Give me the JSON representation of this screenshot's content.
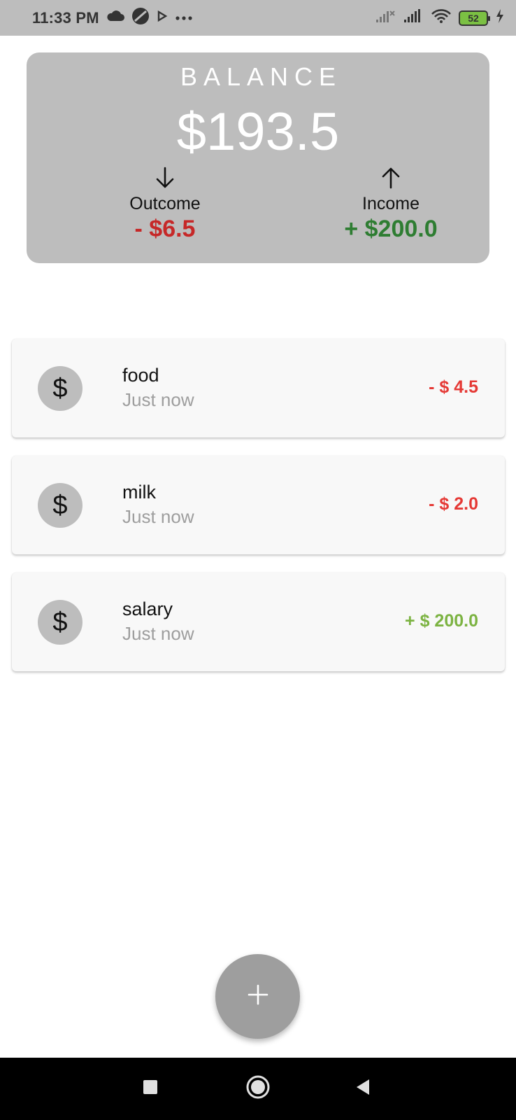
{
  "status_bar": {
    "time": "11:33 PM",
    "left_icons": [
      "cloud-icon",
      "vpn-icon",
      "play-icon",
      "more-dots-icon"
    ],
    "right_icons": [
      "signal-no-service-icon",
      "signal-icon",
      "wifi-icon",
      "battery-icon",
      "charging-icon"
    ],
    "battery_level": "52"
  },
  "balance": {
    "title": "BALANCE",
    "amount": "$193.5",
    "outcome": {
      "label": "Outcome",
      "value": "- $6.5",
      "icon": "arrow-down-icon"
    },
    "income": {
      "label": "Income",
      "value": "+ $200.0",
      "icon": "arrow-up-icon"
    }
  },
  "transactions": [
    {
      "icon_symbol": "$",
      "title": "food",
      "time": "Just now",
      "amount": "- $ 4.5",
      "type": "expense"
    },
    {
      "icon_symbol": "$",
      "title": "milk",
      "time": "Just now",
      "amount": "- $ 2.0",
      "type": "expense"
    },
    {
      "icon_symbol": "$",
      "title": "salary",
      "time": "Just now",
      "amount": "+ $ 200.0",
      "type": "income"
    }
  ],
  "fab": {
    "icon": "plus-icon"
  },
  "nav": {
    "items": [
      "recents-icon",
      "home-icon",
      "back-icon"
    ]
  },
  "colors": {
    "card_gray": "#bdbdbd",
    "expense_red": "#e53935",
    "income_green": "#7cb342",
    "outcome_total_red": "#c62828",
    "income_total_green": "#2e7d32",
    "fab_gray": "#9e9e9e"
  }
}
